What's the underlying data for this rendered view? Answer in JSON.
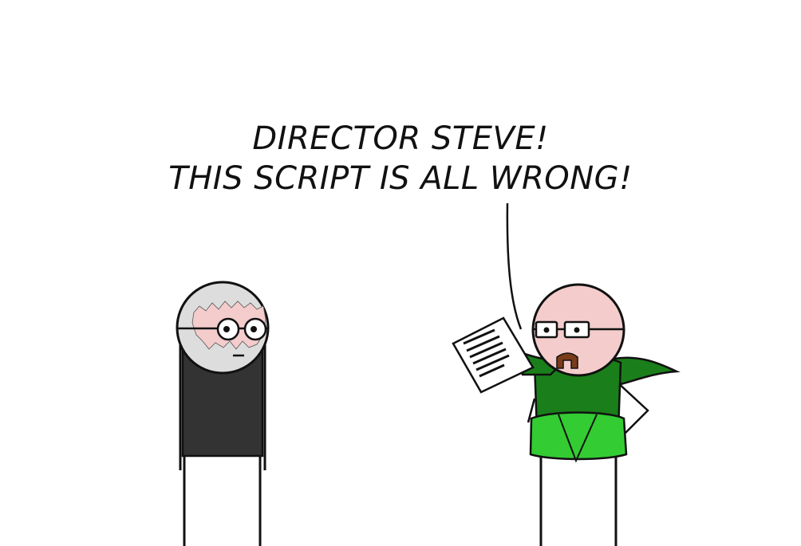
{
  "speech": {
    "line1": "DIRECTOR STEVE!",
    "line2": "THIS SCRIPT IS ALL WRONG!"
  },
  "characters": {
    "director": {
      "shirt_color": "#333333",
      "head_color": "#dddddd",
      "skin_color": "#f4cccc"
    },
    "speaker": {
      "costume_color": "#1a7f1a",
      "trunks_color": "#33cc33",
      "head_color": "#f4cccc"
    }
  },
  "props": {
    "script_icon": "paper-document-icon"
  }
}
